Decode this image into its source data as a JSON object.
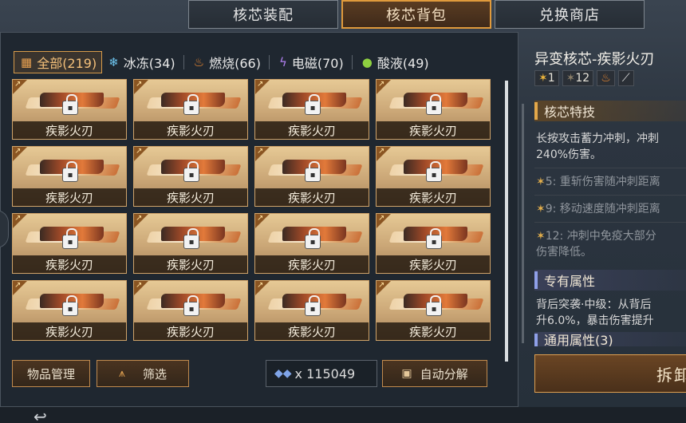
{
  "tabs": [
    {
      "label": "核芯装配",
      "active": false
    },
    {
      "label": "核芯背包",
      "active": true
    },
    {
      "label": "兑换商店",
      "active": false
    }
  ],
  "categories": [
    {
      "label": "全部(219)",
      "icon": "grid-icon",
      "glyph": "▦",
      "color": "#e8a050",
      "active": true
    },
    {
      "label": "冰冻(34)",
      "icon": "snowflake-icon",
      "glyph": "❄",
      "color": "#6ec6f0",
      "active": false
    },
    {
      "label": "燃烧(66)",
      "icon": "flame-icon",
      "glyph": "🔥",
      "color": "#f08a30",
      "active": false
    },
    {
      "label": "电磁(70)",
      "icon": "lightning-icon",
      "glyph": "⚡",
      "color": "#b080f0",
      "active": false
    },
    {
      "label": "酸液(49)",
      "icon": "acid-drop-icon",
      "glyph": "●",
      "color": "#8ed040",
      "active": false
    }
  ],
  "items": [
    {
      "name": "疾影火刃"
    },
    {
      "name": "疾影火刃"
    },
    {
      "name": "疾影火刃"
    },
    {
      "name": "疾影火刃"
    },
    {
      "name": "疾影火刃"
    },
    {
      "name": "疾影火刃"
    },
    {
      "name": "疾影火刃"
    },
    {
      "name": "疾影火刃"
    },
    {
      "name": "疾影火刃"
    },
    {
      "name": "疾影火刃"
    },
    {
      "name": "疾影火刃"
    },
    {
      "name": "疾影火刃"
    },
    {
      "name": "疾影火刃"
    },
    {
      "name": "疾影火刃"
    },
    {
      "name": "疾影火刃"
    },
    {
      "name": "疾影火刃"
    }
  ],
  "footer": {
    "manage_label": "物品管理",
    "filter_label": "筛选",
    "currency_amount": "x 115049",
    "decompose_label": "自动分解"
  },
  "detail": {
    "title": "异变核芯-疾影火刃",
    "star_active": "1",
    "star_inactive": "12",
    "section_skill": "核芯特技",
    "skill_line1": "长按攻击蓄力冲刺，冲刺",
    "skill_line2": "240%伤害。",
    "upgrade1": "5: 重斩伤害随冲刺距离",
    "upgrade2": "9: 移动速度随冲刺距离",
    "upgrade3_line1": "12: 冲刺中免疫大部分",
    "upgrade3_line2": "伤害降低。",
    "section_exclusive": "专有属性",
    "exclusive_line1": "背后突袭·中级：从背后",
    "exclusive_line2": "升6.0%，暴击伤害提升",
    "section_general": "通用属性(3)",
    "action_label": "拆卸"
  },
  "colors": {
    "accent": "#e09a3c",
    "panel": "#1f2730",
    "card_border": "#cfa36a"
  }
}
